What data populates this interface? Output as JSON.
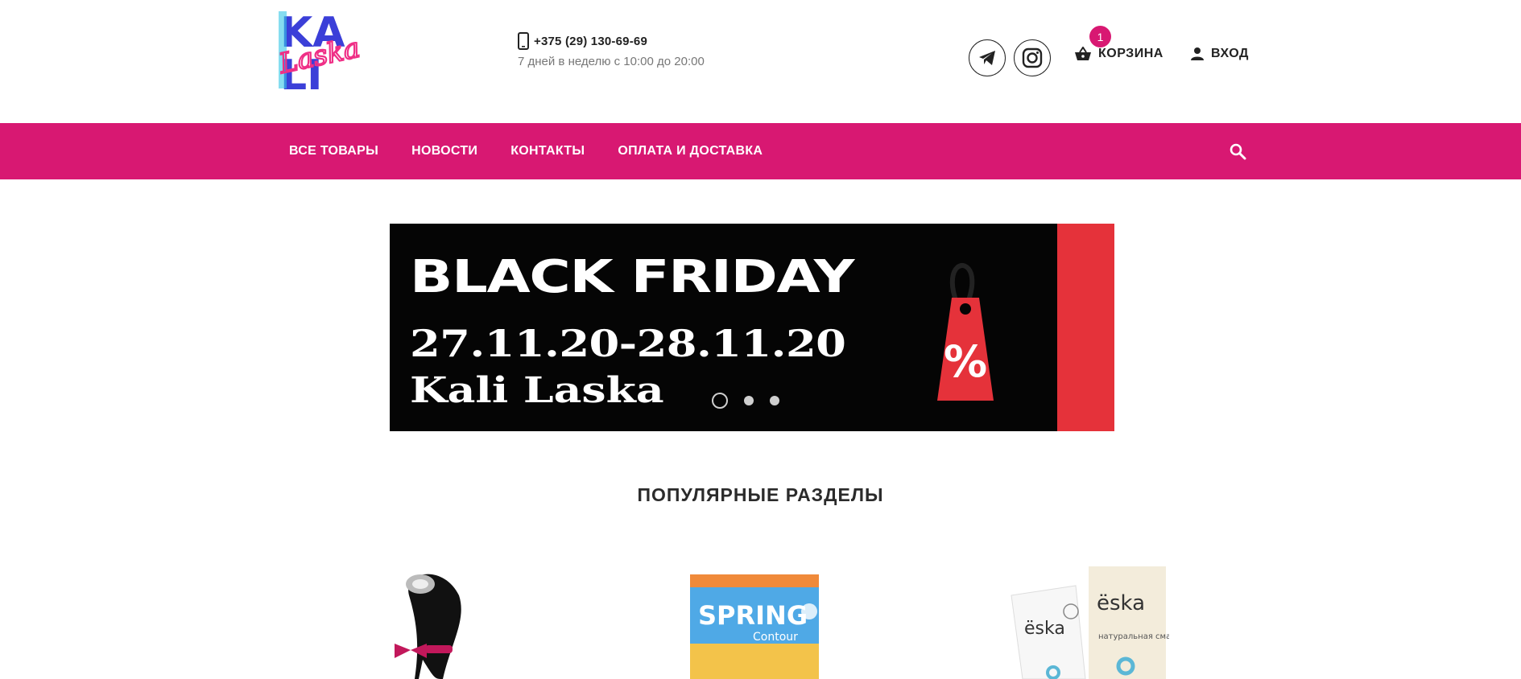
{
  "header": {
    "logo": {
      "text_top": "KA",
      "text_bottom": "LI",
      "script": "Laska"
    },
    "phone": "+375 (29) 130-69-69",
    "hours": "7 дней в неделю с 10:00 до 20:00",
    "cart": {
      "label": "КОРЗИНА",
      "count": "1"
    },
    "login_label": "ВХОД"
  },
  "nav": {
    "items": [
      {
        "label": "ВСЕ ТОВАРЫ"
      },
      {
        "label": "НОВОСТИ"
      },
      {
        "label": "КОНТАКТЫ"
      },
      {
        "label": "ОПЛАТА И ДОСТАВКА"
      }
    ]
  },
  "banner": {
    "title": "BLACK FRIDAY",
    "dates": "27.11.20-28.11.20",
    "brand": "Kali  Laska",
    "tag_symbol": "%",
    "slides_count": 3,
    "active_slide": 1
  },
  "popular": {
    "title": "ПОПУЛЯРНЫЕ РАЗДЕЛЫ",
    "items": [
      {
        "image": "vibrator-penguin"
      },
      {
        "image": "condoms-spring-contour",
        "brand": "SPRING",
        "sub": "Contour"
      },
      {
        "image": "eska-lubricant",
        "brand": "ёska",
        "caption": "натуральная смазка"
      }
    ]
  },
  "colors": {
    "brand": "#d81872",
    "banner_bg": "#050505",
    "banner_accent": "#e5323a"
  }
}
